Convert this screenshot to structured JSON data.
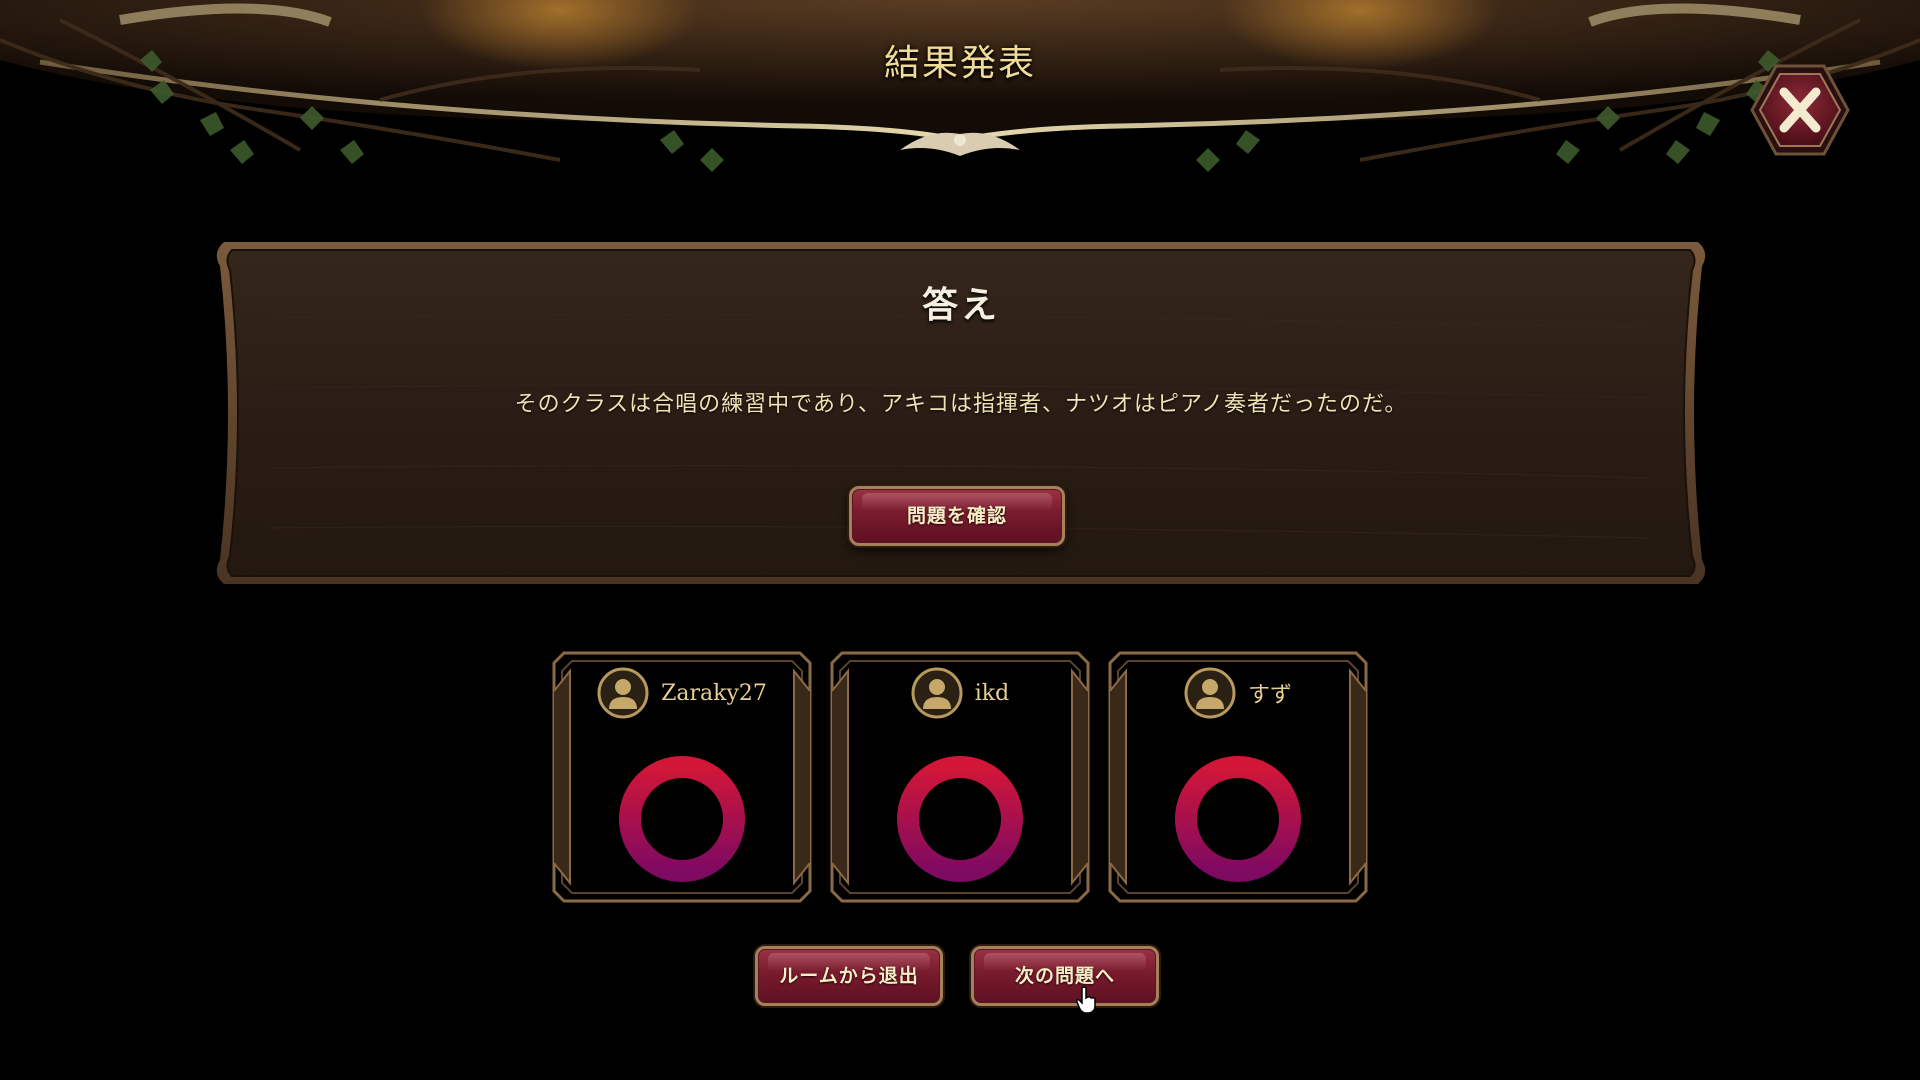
{
  "header": {
    "title": "結果発表"
  },
  "close_button": {
    "icon": "close-icon"
  },
  "answer_panel": {
    "title": "答え",
    "text": "そのクラスは合唱の練習中であり、アキコは指揮者、ナツオはピアノ奏者だったのだ。",
    "check_question_label": "問題を確認"
  },
  "players": [
    {
      "name": "Zaraky27",
      "avatar_icon": "user-avatar-icon",
      "result": "correct",
      "result_mark": "circle"
    },
    {
      "name": "ikd",
      "avatar_icon": "user-avatar-icon",
      "result": "correct",
      "result_mark": "circle"
    },
    {
      "name": "すず",
      "avatar_icon": "user-avatar-icon",
      "result": "correct",
      "result_mark": "circle"
    }
  ],
  "footer": {
    "leave_room_label": "ルームから退出",
    "next_question_label": "次の問題へ"
  },
  "colors": {
    "title_gold": "#f0dc96",
    "frame_gold": "#8a6a44",
    "button_crimson": "#7a1c2e",
    "mark_top": "#d21638",
    "mark_bottom": "#7e0a62",
    "wood_dark": "#2a1d15"
  }
}
